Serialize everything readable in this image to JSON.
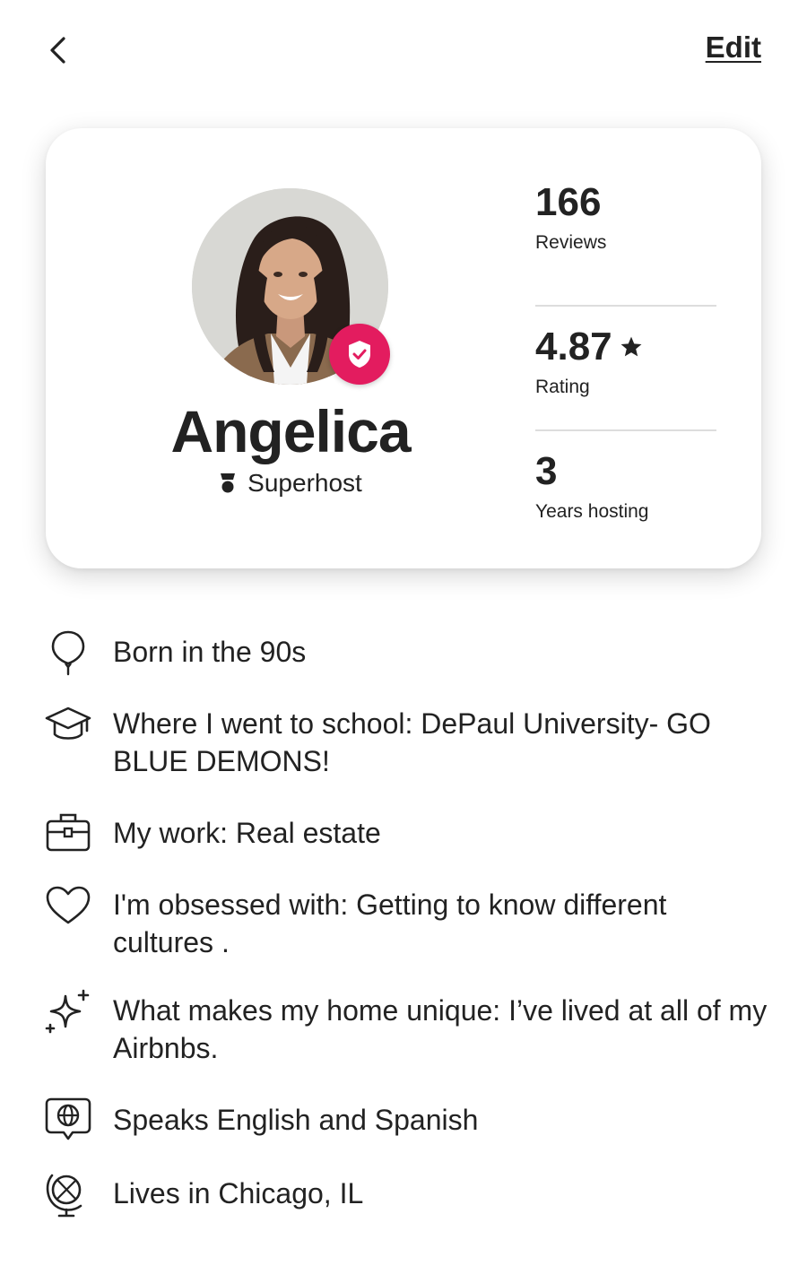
{
  "topbar": {
    "back_icon": "chevron-left-icon",
    "edit_label": "Edit"
  },
  "profile": {
    "name": "Angelica",
    "badge_label": "Superhost",
    "verified_color": "#e31c5f"
  },
  "stats": [
    {
      "value": "166",
      "label": "Reviews"
    },
    {
      "value": "4.87",
      "label": "Rating",
      "icon": "star-icon"
    },
    {
      "value": "3",
      "label": "Years hosting"
    }
  ],
  "facts": [
    {
      "icon": "balloon-icon",
      "text": "Born in the 90s"
    },
    {
      "icon": "graduation-cap-icon",
      "text": "Where I went to school: DePaul University- GO BLUE DEMONS!"
    },
    {
      "icon": "briefcase-icon",
      "text": "My work: Real estate"
    },
    {
      "icon": "heart-icon",
      "text": "I'm obsessed with: Getting to know different cultures ."
    },
    {
      "icon": "sparkles-icon",
      "text": "What makes my home unique: I’ve lived at all of my Airbnbs."
    },
    {
      "icon": "globe-speech-icon",
      "text": "Speaks English and Spanish"
    },
    {
      "icon": "globe-stand-icon",
      "text": "Lives in Chicago, IL"
    }
  ]
}
